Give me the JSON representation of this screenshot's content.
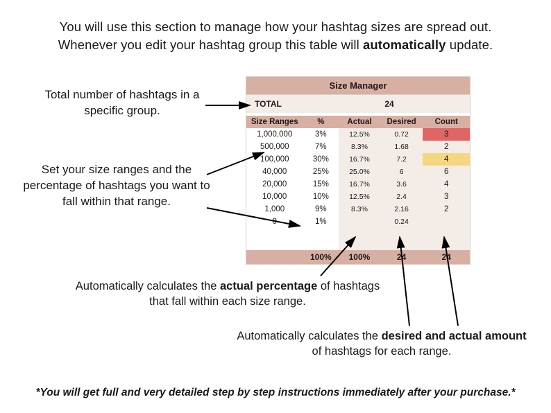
{
  "intro": {
    "line1": "You will use this section to manage how your hashtag sizes are spread out.",
    "line2_pre": "Whenever you edit your hashtag group this table will ",
    "line2_bold": "automatically",
    "line2_post": " update."
  },
  "annotations": {
    "total": "Total number of hashtags in a specific group.",
    "ranges": "Set your size ranges and the percentage of hashtags you want to fall within that range.",
    "actual_pre": "Automatically calculates the ",
    "actual_bold": "actual percentage",
    "actual_post": " of hashtags that fall within each size range.",
    "desired_pre": "Automatically calculates the ",
    "desired_bold": "desired and actual amount",
    "desired_post": " of hashtags for each range."
  },
  "footer": "*You will get full  and very detailed step by step instructions immediately after your purchase.*",
  "table": {
    "title": "Size Manager",
    "total_label": "TOTAL",
    "total_value": "24",
    "headers": {
      "range": "Size Ranges",
      "pct": "%",
      "actual": "Actual",
      "desired": "Desired",
      "count": "Count"
    },
    "rows": [
      {
        "range": "1,000,000",
        "pct": "3%",
        "actual": "12.5%",
        "desired": "0.72",
        "count": "3",
        "hl": "red"
      },
      {
        "range": "500,000",
        "pct": "7%",
        "actual": "8.3%",
        "desired": "1.68",
        "count": "2",
        "hl": ""
      },
      {
        "range": "100,000",
        "pct": "30%",
        "actual": "16.7%",
        "desired": "7.2",
        "count": "4",
        "hl": "yellow"
      },
      {
        "range": "40,000",
        "pct": "25%",
        "actual": "25.0%",
        "desired": "6",
        "count": "6",
        "hl": ""
      },
      {
        "range": "20,000",
        "pct": "15%",
        "actual": "16.7%",
        "desired": "3.6",
        "count": "4",
        "hl": ""
      },
      {
        "range": "10,000",
        "pct": "10%",
        "actual": "12.5%",
        "desired": "2.4",
        "count": "3",
        "hl": ""
      },
      {
        "range": "1,000",
        "pct": "9%",
        "actual": "8.3%",
        "desired": "2.16",
        "count": "2",
        "hl": ""
      },
      {
        "range": "0",
        "pct": "1%",
        "actual": "",
        "desired": "0.24",
        "count": "",
        "hl": ""
      }
    ],
    "footer": {
      "range": "",
      "pct": "100%",
      "actual": "100%",
      "desired": "24",
      "count": "24"
    }
  },
  "chart_data": {
    "type": "table",
    "title": "Size Manager",
    "total": 24,
    "columns": [
      "Size Ranges",
      "%",
      "Actual",
      "Desired",
      "Count"
    ],
    "rows": [
      [
        "1,000,000",
        "3%",
        "12.5%",
        0.72,
        3
      ],
      [
        "500,000",
        "7%",
        "8.3%",
        1.68,
        2
      ],
      [
        "100,000",
        "30%",
        "16.7%",
        7.2,
        4
      ],
      [
        "40,000",
        "25%",
        "25.0%",
        6,
        6
      ],
      [
        "20,000",
        "15%",
        "16.7%",
        3.6,
        4
      ],
      [
        "10,000",
        "10%",
        "12.5%",
        2.4,
        3
      ],
      [
        "1,000",
        "9%",
        "8.3%",
        2.16,
        2
      ],
      [
        "0",
        "1%",
        "",
        0.24,
        null
      ]
    ],
    "totals_row": [
      "",
      "100%",
      "100%",
      24,
      24
    ]
  }
}
